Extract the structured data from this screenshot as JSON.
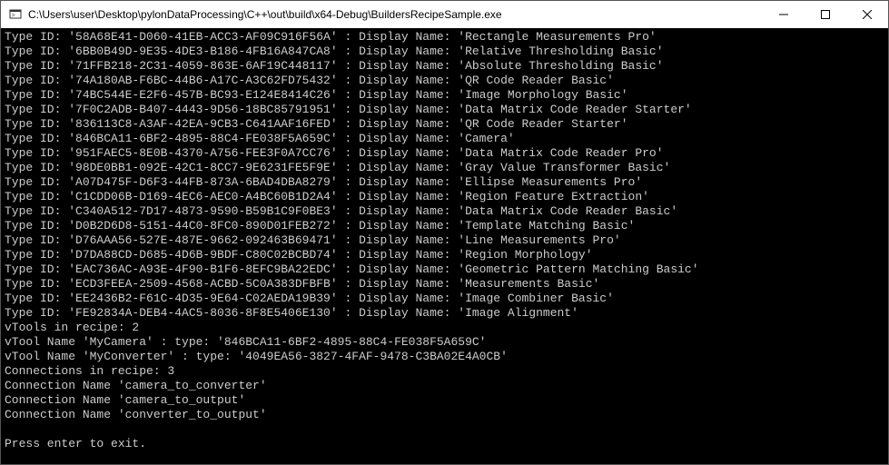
{
  "window": {
    "title": "C:\\Users\\user\\Desktop\\pylonDataProcessing\\C++\\out\\build\\x64-Debug\\BuildersRecipeSample.exe"
  },
  "type_entries": [
    {
      "id": "58A68E41-D060-41EB-ACC3-AF09C916F56A",
      "display_name": "Rectangle Measurements Pro"
    },
    {
      "id": "6BB0B49D-9E35-4DE3-B186-4FB16A847CA8",
      "display_name": "Relative Thresholding Basic"
    },
    {
      "id": "71FFB218-2C31-4059-863E-6AF19C448117",
      "display_name": "Absolute Thresholding Basic"
    },
    {
      "id": "74A180AB-F6BC-44B6-A17C-A3C62FD75432",
      "display_name": "QR Code Reader Basic"
    },
    {
      "id": "74BC544E-E2F6-457B-BC93-E124E8414C26",
      "display_name": "Image Morphology Basic"
    },
    {
      "id": "7F0C2ADB-B407-4443-9D56-18BC85791951",
      "display_name": "Data Matrix Code Reader Starter"
    },
    {
      "id": "836113C8-A3AF-42EA-9CB3-C641AAF16FED",
      "display_name": "QR Code Reader Starter"
    },
    {
      "id": "846BCA11-6BF2-4895-88C4-FE038F5A659C",
      "display_name": "Camera"
    },
    {
      "id": "951FAEC5-8E0B-4370-A756-FEE3F0A7CC76",
      "display_name": "Data Matrix Code Reader Pro"
    },
    {
      "id": "98DE0BB1-092E-42C1-8CC7-9E6231FE5F9E",
      "display_name": "Gray Value Transformer Basic"
    },
    {
      "id": "A07D475F-D6F3-44FB-873A-6BAD4DBA8279",
      "display_name": "Ellipse Measurements Pro"
    },
    {
      "id": "C1CDD06B-D169-4EC6-AEC0-A4BC60B1D2A4",
      "display_name": "Region Feature Extraction"
    },
    {
      "id": "C340A512-7D17-4873-9590-B59B1C9F0BE3",
      "display_name": "Data Matrix Code Reader Basic"
    },
    {
      "id": "D0B2D6D8-5151-44C0-8FC0-890D01FEB272",
      "display_name": "Template Matching Basic"
    },
    {
      "id": "D76AAA56-527E-487E-9662-092463B69471",
      "display_name": "Line Measurements Pro"
    },
    {
      "id": "D7DA88CD-D685-4D6B-9BDF-C80C02BCBD74",
      "display_name": "Region Morphology"
    },
    {
      "id": "EAC736AC-A93E-4F90-B1F6-8EFC9BA22EDC",
      "display_name": "Geometric Pattern Matching Basic"
    },
    {
      "id": "ECD3FEEA-2509-4568-ACBD-5C0A383DFBFB",
      "display_name": "Measurements Basic"
    },
    {
      "id": "EE2436B2-F61C-4D35-9E64-C02AEDA19B39",
      "display_name": "Image Combiner Basic"
    },
    {
      "id": "FE92834A-DEB4-4AC5-8036-8F8E5406E130",
      "display_name": "Image Alignment"
    }
  ],
  "labels": {
    "type_id_prefix": "Type ID: ",
    "display_name_prefix": "Display Name: ",
    "separator": " : ",
    "vtools_count_prefix": "vTools in recipe: ",
    "vtool_name_prefix": "vTool Name ",
    "vtool_type_prefix": " : type: ",
    "connections_count_prefix": "Connections in recipe: ",
    "connection_name_prefix": "Connection Name ",
    "exit_prompt": "Press enter to exit."
  },
  "recipe": {
    "vtools_count": 2,
    "vtools": [
      {
        "name": "MyCamera",
        "type": "846BCA11-6BF2-4895-88C4-FE038F5A659C"
      },
      {
        "name": "MyConverter",
        "type": "4049EA56-3827-4FAF-9478-C3BA02E4A0CB"
      }
    ],
    "connections_count": 3,
    "connections": [
      {
        "name": "camera_to_converter"
      },
      {
        "name": "camera_to_output"
      },
      {
        "name": "converter_to_output"
      }
    ]
  }
}
